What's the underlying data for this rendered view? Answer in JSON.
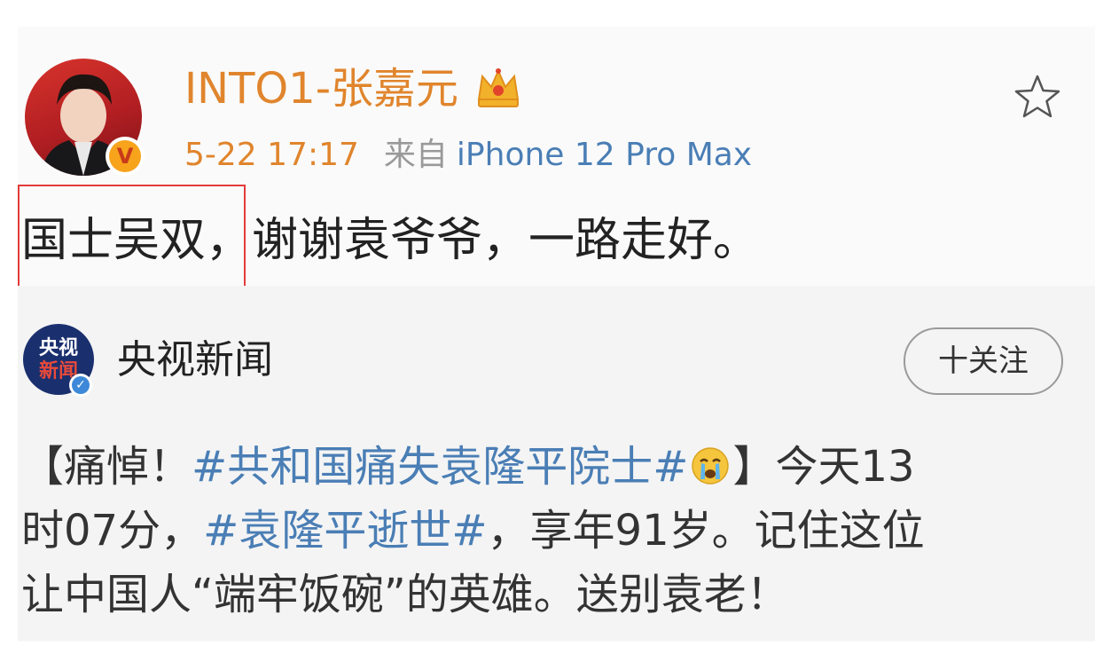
{
  "post": {
    "username": "INTO1-张嘉元",
    "time": "5-22 17:17",
    "from_label": "来自",
    "device": "iPhone 12 Pro Max",
    "text_highlight": "国士吴双",
    "text_rest": "，谢谢袁爷爷，一路走好。"
  },
  "repost": {
    "avatar_line1": "央视",
    "avatar_line2": "新闻",
    "account_name": "央视新闻",
    "follow_label": "十关注",
    "body": {
      "seg1": "【痛悼！",
      "tag1": "#共和国痛失袁隆平院士#",
      "seg2": "】今天13",
      "seg3": "时07分，",
      "tag2": "#袁隆平逝世#",
      "seg4": "，享年91岁。记住这位",
      "line3": "让中国人“端牢饭碗”的英雄。送别袁老！"
    }
  },
  "colors": {
    "username": "#e0852d",
    "link": "#4a7eb5",
    "meta_gray": "#999999",
    "highlight_border": "#e33b3b"
  },
  "icons": [
    "crown-icon",
    "star-icon",
    "verified-badge-icon",
    "crying-emoji-icon"
  ]
}
